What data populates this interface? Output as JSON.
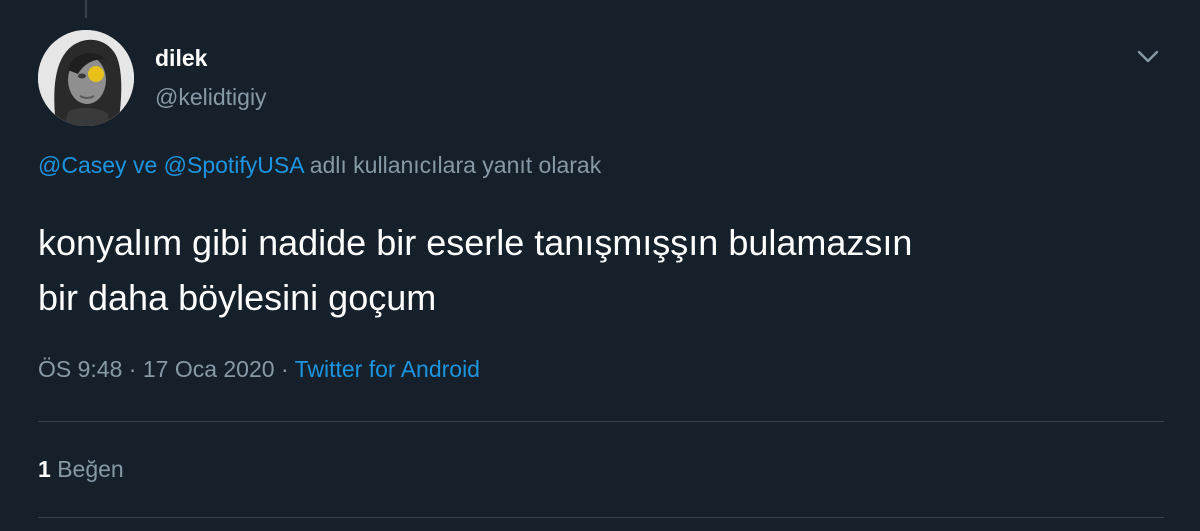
{
  "author": {
    "display_name": "dilek",
    "handle": "@kelidtigiy",
    "avatar_icon": "profile-photo-icon"
  },
  "reply_context": {
    "mention_1": "@Casey",
    "joiner": "ve",
    "mention_2": "@SpotifyUSA",
    "suffix": "adlı kullanıcılara yanıt olarak"
  },
  "tweet": {
    "text_line_1": "konyalım gibi nadide bir eserle tanışmışşın bulamazsın",
    "text_line_2": "bir daha böylesini goçum"
  },
  "meta": {
    "time": "ÖS 9:48",
    "separator": "·",
    "date": "17 Oca 2020",
    "source": "Twitter for Android"
  },
  "stats": {
    "like_count": "1",
    "like_label": "Beğen"
  },
  "colors": {
    "background": "#15202b",
    "primary_text": "#ffffff",
    "secondary_text": "#8899a6",
    "link": "#1b95e0",
    "divider": "#38444d"
  },
  "icons": {
    "caret": "chevron-down-icon"
  }
}
